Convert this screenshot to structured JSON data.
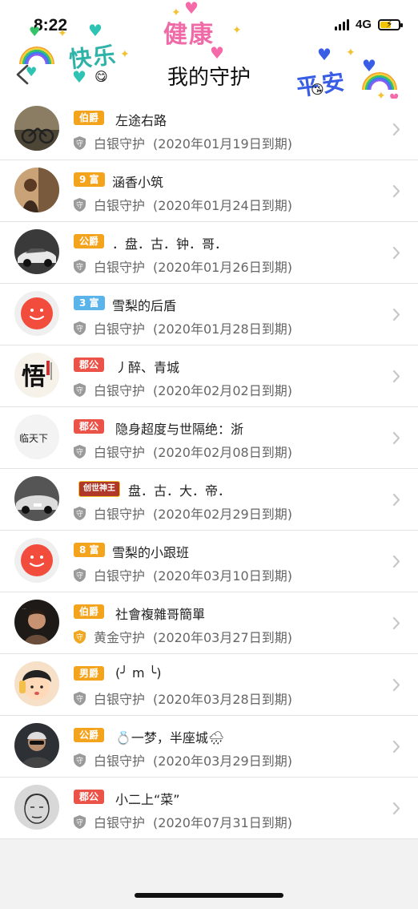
{
  "status_bar": {
    "time": "8:22",
    "network": "4G"
  },
  "header": {
    "title": "我的守护"
  },
  "decorations": {
    "left_text": "快乐",
    "center_text": "健康",
    "right_text": "平安"
  },
  "colors": {
    "gold_badge": "#f4a31c",
    "blue_badge": "#5ab4ea",
    "red_badge": "#ec5348",
    "chevron": "#c7c7c7",
    "guard_silver": "#9a9a9a",
    "guard_gold": "#f0a820"
  },
  "items": [
    {
      "badge": "伯爵",
      "badge_style": "gold",
      "name": "左途右路",
      "guard": "白银守护",
      "guard_tier": "silver",
      "expiry": "(2020年01月19日到期)"
    },
    {
      "badge": "9 富",
      "badge_style": "gold",
      "name": "涵香小筑",
      "guard": "白银守护",
      "guard_tier": "silver",
      "expiry": "(2020年01月24日到期)"
    },
    {
      "badge": "公爵",
      "badge_style": "gold",
      "name": "．盘．古．钟．哥．",
      "guard": "白银守护",
      "guard_tier": "silver",
      "expiry": "(2020年01月26日到期)"
    },
    {
      "badge": "3 富",
      "badge_style": "blue",
      "name": "雪梨的后盾",
      "guard": "白银守护",
      "guard_tier": "silver",
      "expiry": "(2020年01月28日到期)"
    },
    {
      "badge": "郡公",
      "badge_style": "red",
      "name": "丿醉、青城",
      "guard": "白银守护",
      "guard_tier": "silver",
      "expiry": "(2020年02月02日到期)"
    },
    {
      "badge": "郡公",
      "badge_style": "red",
      "name": "隐身超度与世隔绝：浙",
      "guard": "白银守护",
      "guard_tier": "silver",
      "expiry": "(2020年02月08日到期)"
    },
    {
      "badge": "创世神王",
      "badge_style": "crown",
      "name": "盘．古．大．帝．",
      "guard": "白银守护",
      "guard_tier": "silver",
      "expiry": "(2020年02月29日到期)"
    },
    {
      "badge": "8 富",
      "badge_style": "gold",
      "name": "雪梨的小跟班",
      "guard": "白银守护",
      "guard_tier": "silver",
      "expiry": "(2020年03月10日到期)"
    },
    {
      "badge": "伯爵",
      "badge_style": "gold",
      "name": "社會複雜哥簡單",
      "guard": "黄金守护",
      "guard_tier": "gold",
      "expiry": "(2020年03月27日到期)"
    },
    {
      "badge": "男爵",
      "badge_style": "gold",
      "name": "(╯ m ╰)",
      "guard": "白银守护",
      "guard_tier": "silver",
      "expiry": "(2020年03月28日到期)"
    },
    {
      "badge": "公爵",
      "badge_style": "gold",
      "name": "💍一梦，半座城🌧",
      "guard": "白银守护",
      "guard_tier": "silver",
      "expiry": "(2020年03月29日到期)"
    },
    {
      "badge": "郡公",
      "badge_style": "red",
      "name": "小二上“菜”",
      "guard": "白银守护",
      "guard_tier": "silver",
      "expiry": "(2020年07月31日到期)"
    }
  ]
}
